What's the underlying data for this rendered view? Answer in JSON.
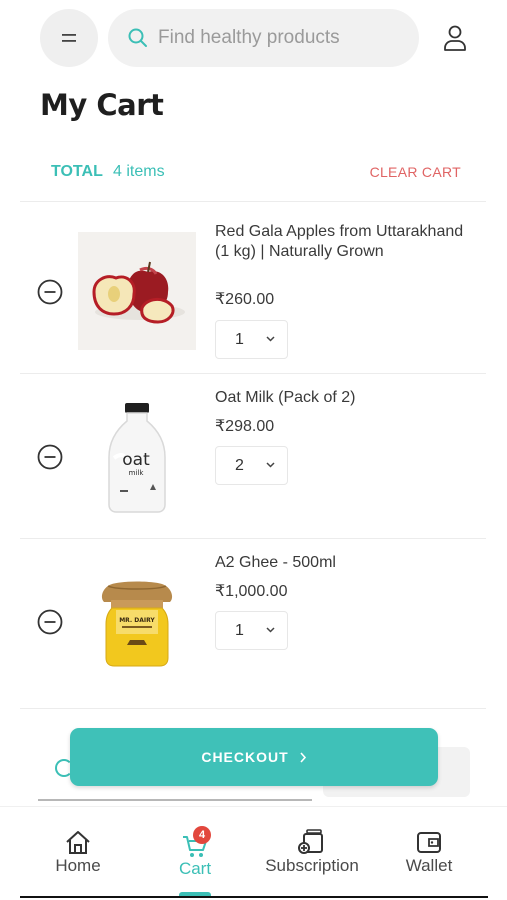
{
  "header": {
    "menu_icon": "hamburger-icon",
    "search_placeholder": "Find healthy products",
    "search_icon": "search-icon",
    "profile_icon": "user-icon"
  },
  "page": {
    "title": "My Cart"
  },
  "summary": {
    "total_label": "TOTAL",
    "item_count": "4 items",
    "clear_label": "CLEAR CART"
  },
  "items": [
    {
      "name": "Red Gala Apples from Uttarakhand (1 kg) | Naturally Grown",
      "price": "₹260.00",
      "qty": "1"
    },
    {
      "name": "Oat Milk (Pack of 2)",
      "price": "₹298.00",
      "qty": "2"
    },
    {
      "name": "A2 Ghee - 500ml",
      "price": "₹1,000.00",
      "qty": "1"
    }
  ],
  "product_art": {
    "milk_brand": "oat",
    "milk_sub": "milk",
    "ghee_brand": "MR. DAIRY"
  },
  "checkout": {
    "label": "CHECKOUT"
  },
  "nav": {
    "items": [
      {
        "label": "Home",
        "icon": "home-icon"
      },
      {
        "label": "Cart",
        "icon": "cart-icon"
      },
      {
        "label": "Subscription",
        "icon": "subscription-icon"
      },
      {
        "label": "Wallet",
        "icon": "wallet-icon"
      }
    ],
    "cart_badge": "4",
    "active": "Cart"
  },
  "colors": {
    "accent": "#3fc1b8",
    "clear": "#e06464",
    "badge": "#e2473d"
  }
}
